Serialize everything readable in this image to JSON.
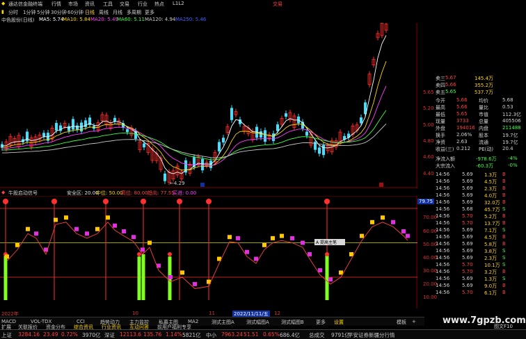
{
  "app": {
    "name": "通达信金融终端",
    "trade_button": "交易"
  },
  "menu": [
    "行情",
    "市场",
    "资讯",
    "工具",
    "交易",
    "行业",
    "热点",
    "L1L2"
  ],
  "periods": [
    "分时",
    "1分钟",
    "5分钟",
    "30分钟",
    "60分钟",
    "日线",
    "周线",
    "月线",
    "多周期",
    "更多"
  ],
  "ma_bar": {
    "stock": "中色股份(日线)",
    "items": [
      {
        "label": "MA5: 5.74",
        "color": "#ffffff"
      },
      {
        "label": "MA10: 5.84",
        "color": "#ffd800"
      },
      {
        "label": "MA20: 5.49",
        "color": "#ff40ff"
      },
      {
        "label": "MA60: 5.11",
        "color": "#40ff40"
      },
      {
        "label": "MA120: 4.94",
        "color": "#c8c8c8"
      },
      {
        "label": "MA250: 5.46",
        "color": "#4060ff"
      }
    ]
  },
  "main_chart": {
    "low_label": "4.29",
    "y_ticks": [
      "5.65",
      "5.20",
      "5.00",
      "4.80",
      "4.60",
      "4.40"
    ]
  },
  "indicator": {
    "name": "牛股启动信号",
    "fields": [
      {
        "label": "安全区: 20.00",
        "color": "#e0e0e0"
      },
      {
        "label": "中位: 50.00",
        "color": "#ffd800"
      },
      {
        "label": "高位: 80.00",
        "color": "#ff4040"
      },
      {
        "label": "趋向: 77.55",
        "color": "#ff4040"
      },
      {
        "label": "买进: 0.00",
        "color": "#ff40ff"
      }
    ],
    "current_value": "79.75",
    "y_ticks": [
      "70.00",
      "60.00",
      "50.00",
      "40.00",
      "30.00",
      "20.00",
      "10.00"
    ],
    "popup": "A 提高主笔"
  },
  "date_axis": {
    "start": "2022年",
    "date1": "10",
    "date2": "11",
    "selected": "2022/11/11/五",
    "date3": "12"
  },
  "quote": {
    "rows": [
      {
        "l": "卖三",
        "v": "5.67",
        "vol": "145.4万",
        "c": "#ff4040"
      },
      {
        "l": "卖四",
        "v": "5.66",
        "vol": "355.2万",
        "c": "#ff4040"
      },
      {
        "l": "卖五",
        "v": "5.65",
        "vol": "537.7万",
        "c": "#40ff40"
      }
    ],
    "stats": [
      {
        "l": "今开",
        "v": "5.66",
        "l2": "均价",
        "v2": "5.68"
      },
      {
        "l": "最高",
        "v": "5.66",
        "l2": "量比",
        "v2": "0.53"
      },
      {
        "l": "最低",
        "v": "5.65",
        "l2": "市值",
        "v2": "112.3亿"
      },
      {
        "l": "现量",
        "v": "3733",
        "l2": "总量",
        "v2": "405506"
      },
      {
        "l": "外盘",
        "v": "194016",
        "l2": "内盘",
        "v2": "211488"
      },
      {
        "l": "换手",
        "v": "2.06%",
        "l2": "股本",
        "v2": "19.7亿"
      },
      {
        "l": "净资",
        "v": "2.63",
        "l2": "流通",
        "v2": "19.7亿"
      },
      {
        "l": "收益(三)",
        "v": "0.212",
        "l2": "PE(动)",
        "v2": "20.4"
      }
    ],
    "flows": [
      {
        "l": "净流入额",
        "v": "-978.6万",
        "p": "-4%"
      },
      {
        "l": "大宗流入",
        "v": "-60.3万",
        "p": "-0%"
      }
    ],
    "ticks": [
      {
        "t": "14:56",
        "p": "5.69",
        "v": "1.3万",
        "s": "B"
      },
      {
        "t": "14:56",
        "p": "5.69",
        "v": "4.5万",
        "s": "B"
      },
      {
        "t": "14:56",
        "p": "5.69",
        "v": "2.3万",
        "s": "B"
      },
      {
        "t": "14:56",
        "p": "5.69",
        "v": "4.0万",
        "s": "B"
      },
      {
        "t": "14:56",
        "p": "5.69",
        "v": "32.0万",
        "s": "B"
      },
      {
        "t": "14:56",
        "p": "5.68",
        "v": "45.7万",
        "s": "S"
      },
      {
        "t": "14:56",
        "p": "5.70",
        "v": "5.2万",
        "s": "B"
      },
      {
        "t": "14:56",
        "p": "5.70",
        "v": "13.7万",
        "s": "B"
      },
      {
        "t": "14:56",
        "p": "5.69",
        "v": "7.1万",
        "s": "S"
      },
      {
        "t": "14:56",
        "p": "5.69",
        "v": "4.5万",
        "s": "B"
      },
      {
        "t": "14:56",
        "p": "5.69",
        "v": "5.8万",
        "s": "B"
      },
      {
        "t": "14:56",
        "p": "5.69",
        "v": "3.8万",
        "s": "S"
      },
      {
        "t": "14:56",
        "p": "5.69",
        "v": "2.3万",
        "s": "S"
      },
      {
        "t": "14:56",
        "p": "5.70",
        "v": "10.1万",
        "s": "S"
      },
      {
        "t": "14:56",
        "p": "5.70",
        "v": "3.2万",
        "s": "B"
      },
      {
        "t": "14:56",
        "p": "5.69",
        "v": "1.3万",
        "s": "S"
      },
      {
        "t": "14:56",
        "p": "5.69",
        "v": "9.0万",
        "s": "B"
      },
      {
        "t": "14:56",
        "p": "5.70",
        "v": "6.1万",
        "s": "B"
      }
    ]
  },
  "tabs": [
    "扩展",
    "关联报价",
    "资金分布",
    "综合资讯",
    "行业资讯",
    "互动问答",
    "前用户福利专享"
  ],
  "indicator_tabs": [
    "MACD",
    "VOL-TDX",
    "CCI",
    "趋势动力",
    "主力监控",
    "私募主图",
    "MA2",
    "测式主图A",
    "测式幅图A",
    "测式幅图B",
    "更多",
    "设置"
  ],
  "tab_right": [
    "模板",
    "+"
  ],
  "status": [
    {
      "label": "上证",
      "color": "#c8c8c8"
    },
    {
      "label": "3284.16",
      "color": "#ff4040"
    },
    {
      "label": "23.49",
      "color": "#ff4040"
    },
    {
      "label": "0.72%",
      "color": "#ff4040"
    },
    {
      "label": "3970亿",
      "color": "#c8c8c8"
    },
    {
      "label": "深证",
      "color": "#c8c8c8"
    },
    {
      "label": "12113.6",
      "color": "#ff4040"
    },
    {
      "label": "135.76",
      "color": "#ff4040"
    },
    {
      "label": "1.14%",
      "color": "#ff4040"
    },
    {
      "label": "5821亿",
      "color": "#c8c8c8"
    },
    {
      "label": "中小",
      "color": "#c8c8c8"
    },
    {
      "label": "7963.24",
      "color": "#ff4040"
    },
    {
      "label": "51.51",
      "color": "#ff4040"
    },
    {
      "label": "0.65%",
      "color": "#ff4040"
    },
    {
      "label": "686.4亿",
      "color": "#c8c8c8"
    },
    {
      "label": "总成交",
      "color": "#c8c8c8"
    },
    {
      "label": "9791亿",
      "color": "#c8c8c8"
    },
    {
      "label": "平安证券新疆分行情",
      "color": "#c8c8c8"
    }
  ],
  "watermark": "www.7gpzb.com",
  "bottom_right_tag": "图文F10"
}
